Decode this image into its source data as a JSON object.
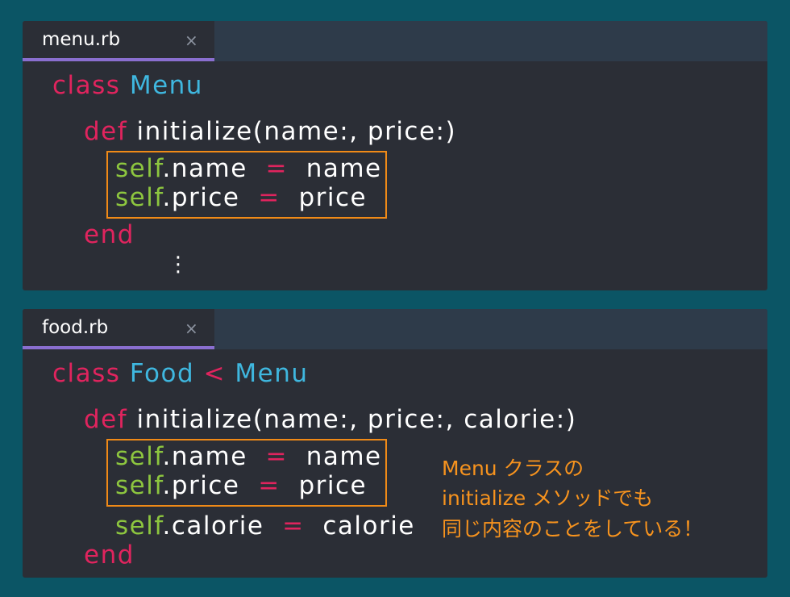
{
  "editors": [
    {
      "tab": {
        "filename": "menu.rb",
        "close": "×"
      },
      "code": {
        "class_kw": "class",
        "class_name": "Menu",
        "def_kw": "def",
        "def_sig": "initialize(name:, price:)",
        "self1": "self",
        "rest1": ".name",
        "eq1": "=",
        "val1": "name",
        "self2": "self",
        "rest2": ".price",
        "eq2": "=",
        "val2": "price",
        "end_kw": "end",
        "ellipsis": "⋮"
      }
    },
    {
      "tab": {
        "filename": "food.rb",
        "close": "×"
      },
      "code": {
        "class_kw": "class",
        "class_name": "Food",
        "lt": "<",
        "parent": "Menu",
        "def_kw": "def",
        "def_sig": "initialize(name:, price:, calorie:)",
        "self1": "self",
        "rest1": ".name",
        "eq1": "=",
        "val1": "name",
        "self2": "self",
        "rest2": ".price",
        "eq2": "=",
        "val2": "price",
        "self3": "self",
        "rest3": ".calorie",
        "eq3": "=",
        "val3": "calorie",
        "end_kw": "end"
      }
    }
  ],
  "annotation": {
    "line1": "Menu クラスの",
    "line2": "initialize メソッドでも",
    "line3": "同じ内容のことをしている！"
  },
  "colors": {
    "background": "#0b5565",
    "editor": "#2b2e36",
    "keyword": "#e0245e",
    "class_name": "#3fb7df",
    "self": "#8dc63f",
    "highlight": "#f08a17",
    "tab_underline": "#8a6fd0"
  }
}
